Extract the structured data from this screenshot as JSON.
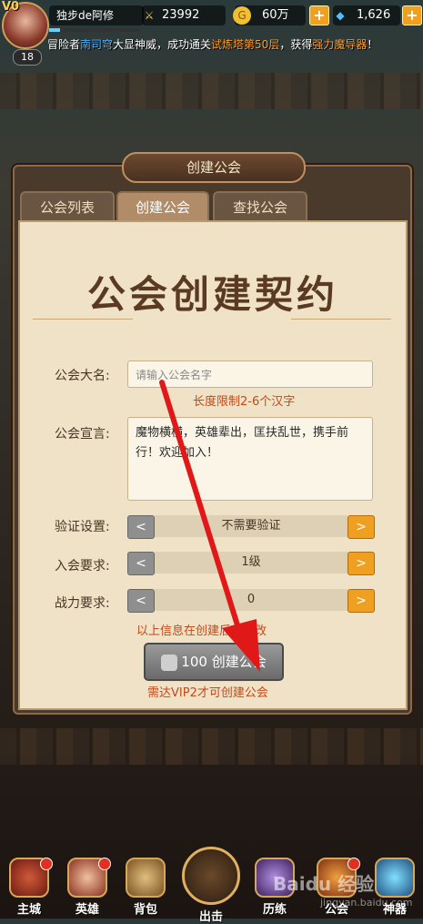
{
  "player": {
    "vip": "V0",
    "level": "18",
    "name": "独步de阿修",
    "power": "23992",
    "gold": "60万",
    "diamonds": "1,626"
  },
  "marquee": {
    "prefix": "冒险者",
    "hero": "南司穹",
    "text1": "大显神威，成功通关",
    "tower": "试炼塔第50层",
    "text2": "，获得",
    "item": "强力魔导器",
    "text3": "！"
  },
  "dialog": {
    "title": "创建公会",
    "tabs": [
      "公会列表",
      "创建公会",
      "查找公会"
    ],
    "active_tab": 1,
    "heading": "公会创建契约",
    "name_label": "公会大名:",
    "name_placeholder": "请输入公会名字",
    "name_hint": "长度限制2-6个汉字",
    "declaration_label": "公会宣言:",
    "declaration_value": "魔物横横，英雄辈出，匡扶乱世，携手前行！欢迎加入！",
    "verify_label": "验证设置:",
    "verify_value": "不需要验证",
    "join_label": "入会要求:",
    "join_value": "1级",
    "power_label": "战力要求:",
    "power_value": "0",
    "modify_note": "以上信息在创建后可修改",
    "create_cost": "100",
    "create_label": "创建公会",
    "vip_note": "需达VIP2才可创建公会"
  },
  "nav": [
    "主城",
    "英雄",
    "背包",
    "出击",
    "历练",
    "公会",
    "神器"
  ],
  "watermark": "Baidu 经验",
  "watermark_url": "jingyan.baidu.com"
}
